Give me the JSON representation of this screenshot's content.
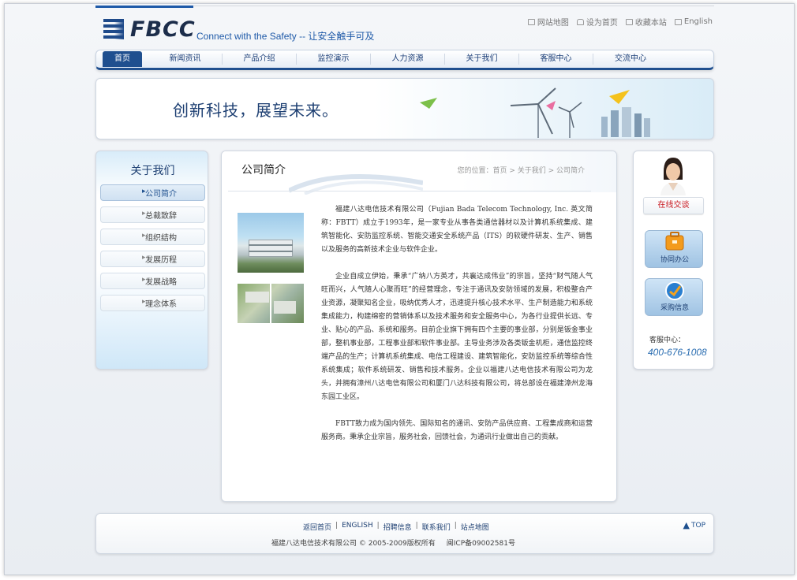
{
  "header": {
    "logo_text": "FBCC",
    "slogan": "Connect with the Safety  -- 让安全触手可及",
    "top_links": [
      {
        "label": "网站地图",
        "icon": "sitemap-icon"
      },
      {
        "label": "设为首页",
        "icon": "home-icon"
      },
      {
        "label": "收藏本站",
        "icon": "bookmark-icon"
      },
      {
        "label": "English",
        "icon": "language-icon"
      }
    ]
  },
  "nav": {
    "items": [
      "首页",
      "新闻资讯",
      "产品介绍",
      "监控演示",
      "人力资源",
      "关于我们",
      "客服中心",
      "交流中心"
    ],
    "active": "首页"
  },
  "banner": {
    "text": "创新科技，展望未来。"
  },
  "sidebar": {
    "title": "关于我们",
    "items": [
      "公司简介",
      "总裁致辞",
      "组织结构",
      "发展历程",
      "发展战略",
      "理念体系"
    ],
    "active": "公司简介"
  },
  "main": {
    "title": "公司简介",
    "breadcrumb": "您的位置：首页 > 关于我们 > 公司简介",
    "paragraphs": [
      "福建八达电信技术有限公司（Fujian Bada Telecom Technology, Inc. 英文简称：FBTT）成立于1993年，是一家专业从事各类通信器材以及计算机系统集成、建筑智能化、安防监控系统、智能交通安全系统产品（ITS）的软硬件研发、生产、销售以及服务的高新技术企业与软件企业。",
      "企业自成立伊始，秉承“广纳八方英才，共襄达成伟业”的宗旨，坚持“财气随人气旺而兴，人气随人心聚而旺”的经营理念，专注于通讯及安防领域的发展，积极整合产业资源，凝聚知名企业，吸纳优秀人才，迅速提升核心技术水平、生产制造能力和系统集成能力，构建绵密的营销体系以及技术服务和安全服务中心，为各行业提供长远、专业、贴心的产品、系统和服务。目前企业旗下拥有四个主要的事业部，分别是钣金事业部，整机事业部，工程事业部和软件事业部。主导业务涉及各类钣金机柜，通信监控终端产品的生产；计算机系统集成、电信工程建设、建筑智能化，安防监控系统等综合性系统集成；软件系统研发、销售和技术服务。企业以福建八达电信技术有限公司为龙头，并拥有漳州八达电信有限公司和厦门八达科技有限公司，将总部设在福建漳州龙海东园工业区。",
      "FBTT致力成为国内领先、国际知名的通讯、安防产品供应商、工程集成商和运营服务商。秉承企业宗旨，服务社会，回馈社会，为通讯行业做出自己的贡献。"
    ]
  },
  "right": {
    "chat_label": "在线交谈",
    "quick_links": [
      {
        "label": "协同办公",
        "icon": "office-briefcase-icon"
      },
      {
        "label": "采购信息",
        "icon": "purchase-info-icon"
      }
    ],
    "service_label": "客服中心：",
    "service_phone": "400-676-1008"
  },
  "footer": {
    "links": [
      "返回首页",
      "ENGLISH",
      "招聘信息",
      "联系我们",
      "站点地图"
    ],
    "company": "福建八达电信技术有限公司 © 2005-2009版权所有",
    "icp": "闽ICP备09002581号",
    "top_label": "TOP"
  },
  "colors": {
    "brand_blue": "#1f4f8f",
    "link_blue": "#1d3f72",
    "phone_blue": "#2a6db1",
    "chat_red": "#c8161d"
  }
}
